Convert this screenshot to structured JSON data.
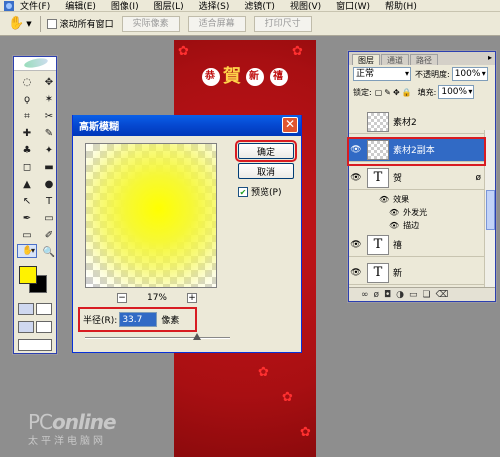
{
  "menubar": {
    "items": [
      "文件(F)",
      "编辑(E)",
      "图像(I)",
      "图层(L)",
      "选择(S)",
      "滤镜(T)",
      "视图(V)",
      "窗口(W)",
      "帮助(H)"
    ]
  },
  "options_bar": {
    "scroll_all_label": "滚动所有窗口",
    "buttons": [
      "实际像素",
      "适合屏幕",
      "打印尺寸"
    ]
  },
  "toolbox": {
    "tools": [
      "marquee-icon",
      "move-icon",
      "lasso-icon",
      "magic-wand-icon",
      "crop-icon",
      "slice-icon",
      "healing-icon",
      "brush-icon",
      "stamp-icon",
      "history-brush-icon",
      "eraser-icon",
      "gradient-icon",
      "blur-icon",
      "dodge-icon",
      "path-select-icon",
      "type-icon",
      "pen-icon",
      "shape-icon",
      "notes-icon",
      "eyedropper-icon",
      "hand-icon",
      "zoom-icon"
    ],
    "tool_glyphs": [
      "◌",
      "✥",
      "ϙ",
      "✶",
      "⌗",
      "✂",
      "✚",
      "✎",
      "♣",
      "✦",
      "◻",
      "▬",
      "▲",
      "●",
      "↖",
      "T",
      "✒",
      "▭",
      "▭",
      "✐",
      "✋",
      "🔍"
    ],
    "foreground_color": "#fff200",
    "background_color": "#000000"
  },
  "canvas": {
    "characters": [
      "恭",
      "賀",
      "新",
      "禧"
    ]
  },
  "watermark": {
    "brand_main": "PC",
    "brand_rest": "online",
    "tagline": "太平洋电脑网"
  },
  "dialog": {
    "title": "高斯模糊",
    "ok_label": "确定",
    "cancel_label": "取消",
    "preview_label": "预览(P)",
    "preview_checked": true,
    "zoom_minus": "−",
    "zoom_value": "17%",
    "zoom_plus": "+",
    "radius_label": "半径(R):",
    "radius_value": "33.7",
    "radius_unit": "像素",
    "close_symbol": "✕"
  },
  "layers_panel": {
    "tabs": [
      "图层",
      "通道",
      "路径"
    ],
    "menu_symbol": "▸",
    "blend_mode": "正常",
    "opacity_label": "不透明度:",
    "opacity_value": "100%",
    "lock_label": "锁定:",
    "fill_label": "填充:",
    "fill_value": "100%",
    "layers": [
      {
        "name": "素材2",
        "visible": false,
        "thumb": ""
      },
      {
        "name": "素材2副本",
        "visible": true,
        "thumb": "",
        "active": true
      },
      {
        "name": "贺",
        "visible": true,
        "thumb": "T",
        "fx": "ø"
      },
      {
        "name": "禧",
        "visible": true,
        "thumb": "T"
      },
      {
        "name": "新",
        "visible": true,
        "thumb": "T"
      }
    ],
    "effects_label": "效果",
    "effects": [
      "外发光",
      "描边"
    ],
    "footer_icons": [
      "link-icon",
      "fx-icon",
      "mask-icon",
      "adjustment-icon",
      "group-icon",
      "new-layer-icon",
      "trash-icon"
    ],
    "footer_glyphs": [
      "∞",
      "ø",
      "◘",
      "◑",
      "▭",
      "❏",
      "⌫"
    ]
  }
}
